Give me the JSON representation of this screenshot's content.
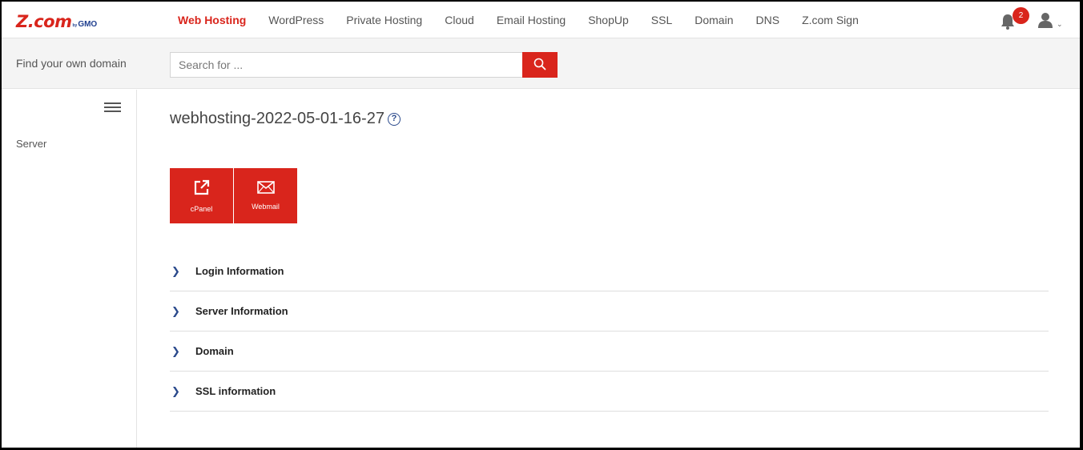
{
  "brand": {
    "logo_main": "Z.com",
    "logo_by": "by",
    "logo_gmo": "GMO",
    "accent": "#d9251c",
    "secondary": "#2b4a8c"
  },
  "topnav": {
    "items": [
      {
        "label": "Web Hosting",
        "active": true
      },
      {
        "label": "WordPress"
      },
      {
        "label": "Private Hosting"
      },
      {
        "label": "Cloud"
      },
      {
        "label": "Email Hosting"
      },
      {
        "label": "ShopUp"
      },
      {
        "label": "SSL"
      },
      {
        "label": "Domain"
      },
      {
        "label": "DNS"
      },
      {
        "label": "Z.com Sign"
      }
    ],
    "notifications_count": "2",
    "bell_icon": "bell-icon",
    "user_icon": "user-icon"
  },
  "search": {
    "label": "Find your own domain",
    "placeholder": "Search for ...",
    "button_icon": "search-icon"
  },
  "sidebar": {
    "menu_icon": "hamburger-icon",
    "items": [
      {
        "label": "Server"
      }
    ]
  },
  "main": {
    "title": "webhosting-2022-05-01-16-27",
    "help_icon": "help-icon",
    "tiles": [
      {
        "label": "cPanel",
        "icon": "external-link-icon"
      },
      {
        "label": "Webmail",
        "icon": "envelope-icon"
      }
    ],
    "sections": [
      {
        "label": "Login Information"
      },
      {
        "label": "Server Information"
      },
      {
        "label": "Domain"
      },
      {
        "label": "SSL information"
      }
    ],
    "chevron": "❯"
  }
}
